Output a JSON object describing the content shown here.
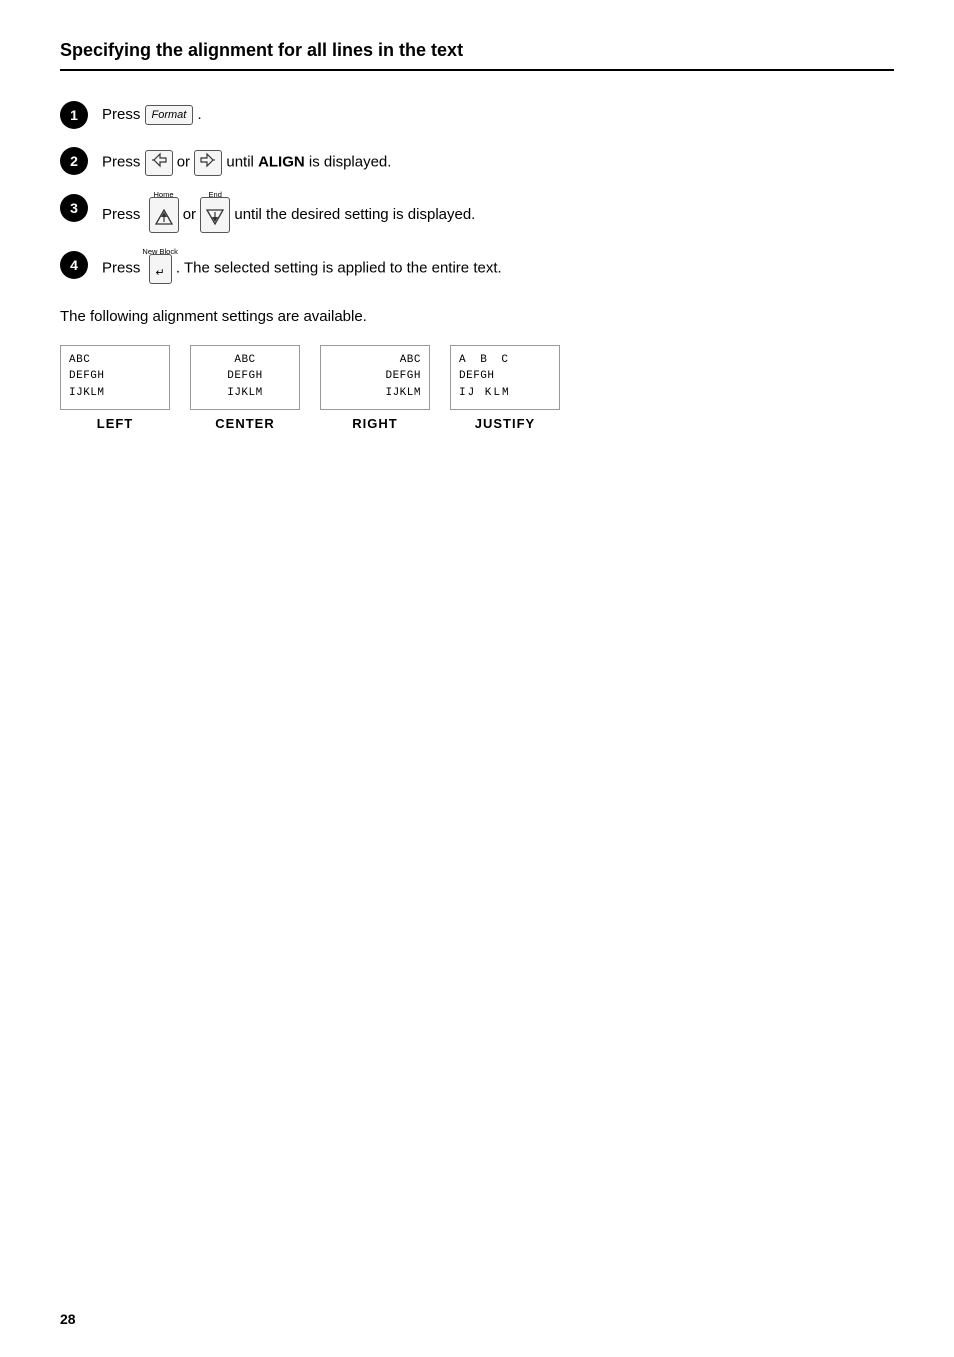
{
  "page": {
    "title": "Specifying the alignment for all lines in the text",
    "steps": [
      {
        "number": "1",
        "text_prefix": "Press",
        "key": "Format",
        "text_suffix": "."
      },
      {
        "number": "2",
        "text_prefix": "Press",
        "key_left": "◁",
        "key_separator": "or",
        "key_right": "▷",
        "text_middle": "until",
        "bold_word": "ALIGN",
        "text_suffix": "is displayed."
      },
      {
        "number": "3",
        "text_prefix": "Press",
        "key_up_label": "Home",
        "key_up": "△",
        "key_separator": "or",
        "key_down_label": "End",
        "key_down": "▽",
        "text_suffix": "until the desired setting is displayed."
      },
      {
        "number": "4",
        "text_prefix": "Press",
        "key_label": "New Block",
        "key": "↵",
        "text_suffix": ". The selected setting is applied to the entire text."
      }
    ],
    "following_text": "The following alignment settings are available.",
    "alignment_samples": [
      {
        "type": "left",
        "lines": [
          "ABC",
          "DEFGH",
          "IJKLM"
        ],
        "label": "LEFT"
      },
      {
        "type": "center",
        "lines": [
          "ABC",
          "DEFGH",
          "IJKLM"
        ],
        "label": "CENTER"
      },
      {
        "type": "right",
        "lines": [
          "ABC",
          "DEFGH",
          "IJKLM"
        ],
        "label": "RIGHT"
      },
      {
        "type": "justify",
        "lines": [
          "A  B  C",
          "DEFGH",
          "IJ KLM"
        ],
        "label": "JUSTIFY"
      }
    ],
    "page_number": "28"
  }
}
